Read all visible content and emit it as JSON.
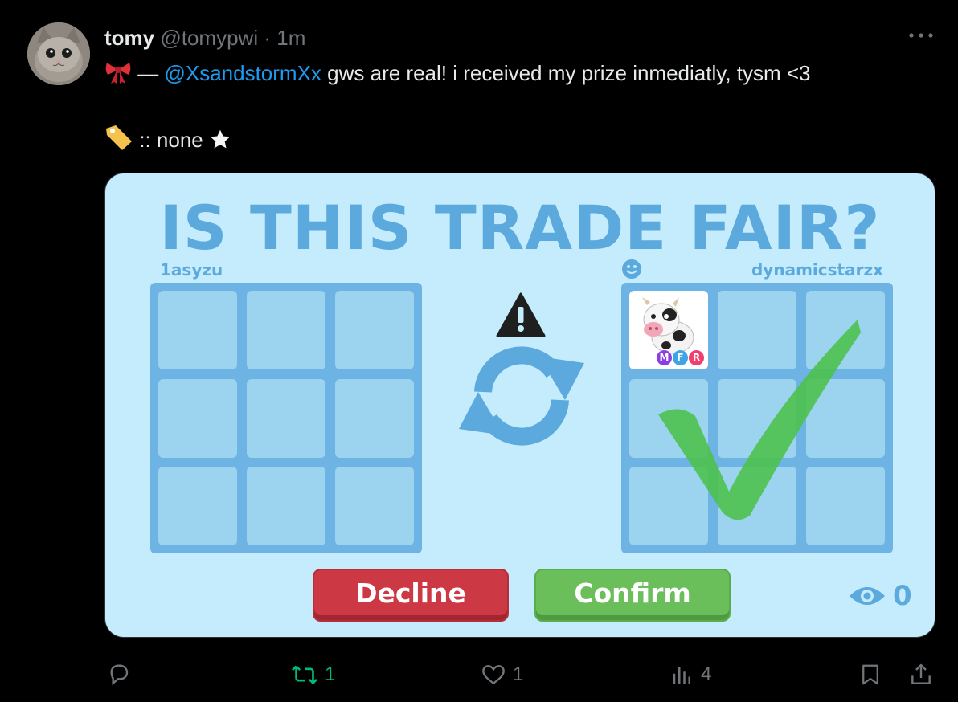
{
  "post": {
    "author_name": "tomy",
    "handle": "@tomypwi",
    "separator": "·",
    "time": "1m",
    "text_prefix": "—",
    "mention": "@XsandstormXx",
    "text_rest": "gws are real! i received my prize inmediatly, tysm <3",
    "tag_line": ":: none",
    "icons": [
      "ribbon-emoji",
      "label-tag-emoji",
      "star-emoji"
    ]
  },
  "trade": {
    "title": "IS THIS TRADE FAIR?",
    "left_user": "1asyzu",
    "right_user": "dynamicstarzx",
    "decline_label": "Decline",
    "confirm_label": "Confirm",
    "viewer_count": "0",
    "item_badges": [
      "M",
      "F",
      "R"
    ],
    "colors": {
      "panel": "#c4ecfc",
      "accent": "#5ba9dd",
      "decline": "#cd3845",
      "confirm": "#6abf5a",
      "check": "#4cc24a"
    }
  },
  "actions": {
    "reply_count": "",
    "retweet_count": "1",
    "like_count": "1",
    "views_count": "4"
  }
}
